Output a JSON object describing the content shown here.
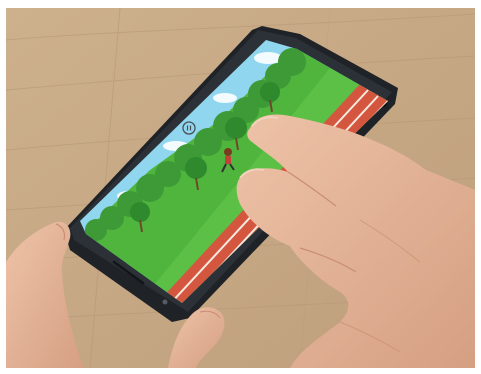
{
  "photo": {
    "frame_color": "#ffffff",
    "table_color": "#c9ab86",
    "table_grain_color": "#b69675"
  },
  "phone": {
    "body_color": "#22262b",
    "pause_icon": "pause-circle-icon"
  },
  "game": {
    "sky_color": "#8fd6ee",
    "grass_color": "#4fb53c",
    "tree_color": "#3d9a36",
    "track_color": "#d5563f",
    "lane_line_color": "#f6e9df",
    "character": "runner-character"
  },
  "hands": {
    "skin_color": "#e6b89c",
    "shadow_color": "#c98e72"
  }
}
